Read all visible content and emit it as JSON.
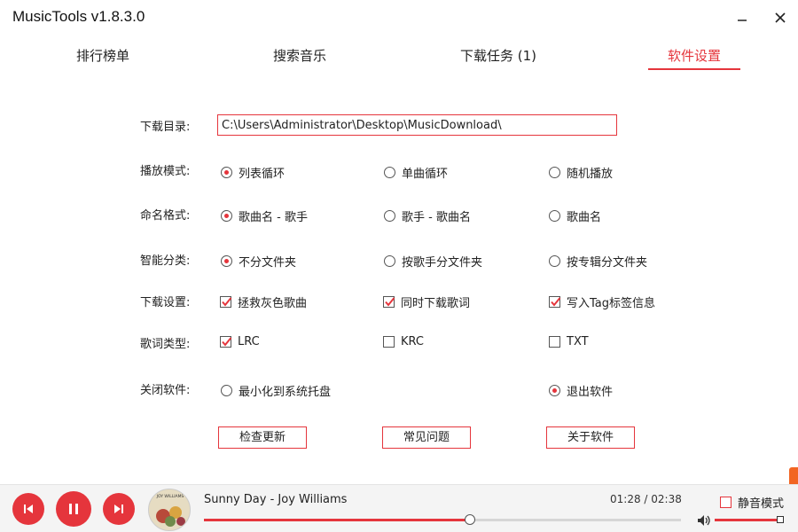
{
  "window": {
    "title": "MusicTools v1.8.3.0",
    "minimize_glyph": "—",
    "close_glyph": "✕"
  },
  "tabs": [
    {
      "label": "排行榜单",
      "active": false
    },
    {
      "label": "搜索音乐",
      "active": false
    },
    {
      "label": "下载任务 (1)",
      "active": false
    },
    {
      "label": "软件设置",
      "active": true
    }
  ],
  "settings": {
    "download_dir": {
      "label": "下载目录:",
      "value": "C:\\Users\\Administrator\\Desktop\\MusicDownload\\"
    },
    "play_mode": {
      "label": "播放模式:",
      "options": [
        "列表循环",
        "单曲循环",
        "随机播放"
      ],
      "selected": 0
    },
    "naming": {
      "label": "命名格式:",
      "options": [
        "歌曲名 - 歌手",
        "歌手 - 歌曲名",
        "歌曲名"
      ],
      "selected": 0
    },
    "classify": {
      "label": "智能分类:",
      "options": [
        "不分文件夹",
        "按歌手分文件夹",
        "按专辑分文件夹"
      ],
      "selected": 0
    },
    "download": {
      "label": "下载设置:",
      "options": [
        "拯救灰色歌曲",
        "同时下载歌词",
        "写入Tag标签信息"
      ],
      "checked": [
        true,
        true,
        true
      ]
    },
    "lyric_type": {
      "label": "歌词类型:",
      "options": [
        "LRC",
        "KRC",
        "TXT"
      ],
      "checked": [
        true,
        false,
        false
      ]
    },
    "close": {
      "label": "关闭软件:",
      "options": [
        "最小化到系统托盘",
        "退出软件"
      ],
      "selected": 1
    }
  },
  "buttons": {
    "check_update": "检查更新",
    "faq": "常见问题",
    "about": "关于软件"
  },
  "player": {
    "song": "Sunny Day - Joy Williams",
    "elapsed": "01:28",
    "duration": "02:38",
    "time_display": "01:28 / 02:38",
    "progress": 0.557,
    "mute_label": "静音模式",
    "muted": false,
    "volume": 1.0,
    "album_text": "JOY WILLIAMS"
  },
  "colors": {
    "accent": "#e5353c",
    "player_bg": "#f4f4f4"
  }
}
